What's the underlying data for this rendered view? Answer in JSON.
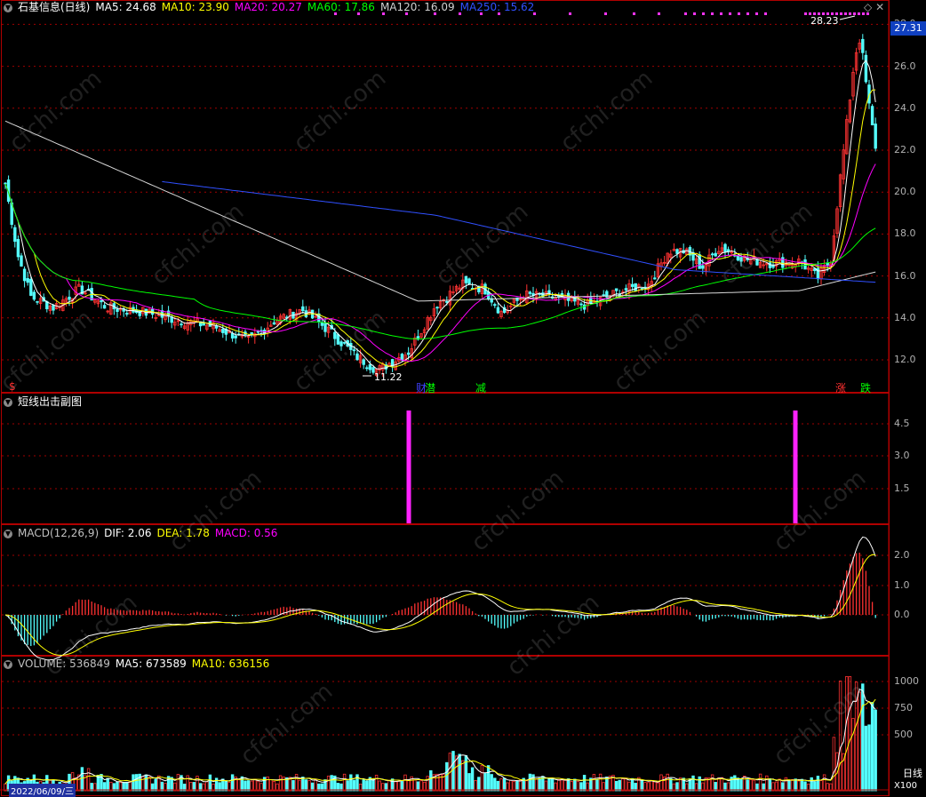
{
  "main": {
    "title": "石基信息(日线)",
    "ma_labels": [
      {
        "text": "MA5: 24.68",
        "color": "#ffffff"
      },
      {
        "text": "MA10: 23.90",
        "color": "#ffff00"
      },
      {
        "text": "MA20: 20.27",
        "color": "#ff00ff"
      },
      {
        "text": "MA60: 17.86",
        "color": "#00ff00"
      },
      {
        "text": "MA120: 16.09",
        "color": "#d0d0d0"
      },
      {
        "text": "MA250: 15.62",
        "color": "#3050ff"
      }
    ],
    "y_ticks": [
      "28.0",
      "26.0",
      "24.0",
      "22.0",
      "20.0",
      "18.0",
      "16.0",
      "14.0",
      "12.0"
    ],
    "last_price": "27.31",
    "high_label": "28.23",
    "low_label": "11.22",
    "markers": [
      {
        "text": "$",
        "color": "#ff3030"
      },
      {
        "text": "财",
        "color": "#4040ff"
      },
      {
        "text": "潜",
        "color": "#00ff00"
      },
      {
        "text": "减",
        "color": "#00ff00"
      },
      {
        "text": "涨",
        "color": "#ff3030"
      },
      {
        "text": "跌",
        "color": "#00ff00"
      }
    ]
  },
  "sub1": {
    "title": "短线出击副图",
    "y_ticks": [
      "4.5",
      "3.0",
      "1.5"
    ],
    "bars": [
      1,
      1
    ]
  },
  "macd": {
    "labels": [
      {
        "text": "MACD(12,26,9)",
        "color": "#c0c0c0"
      },
      {
        "text": "DIF: 2.06",
        "color": "#ffffff"
      },
      {
        "text": "DEA: 1.78",
        "color": "#ffff00"
      },
      {
        "text": "MACD: 0.56",
        "color": "#ff00ff"
      }
    ],
    "y_ticks": [
      "2.0",
      "1.0",
      "0.0"
    ]
  },
  "volume": {
    "labels": [
      {
        "text": "VOLUME: 536849",
        "color": "#c0c0c0"
      },
      {
        "text": "MA5: 673589",
        "color": "#ffffff"
      },
      {
        "text": "MA10: 636156",
        "color": "#ffff00"
      }
    ],
    "y_ticks": [
      "1000",
      "750",
      "500"
    ],
    "unit": "X100",
    "date": "2022/06/09/三"
  },
  "sidebar_label": "日线",
  "watermark": "cfchi.com",
  "colors": {
    "up": "#ff3232",
    "down": "#54ffff",
    "grid": "#a00000",
    "border": "#b00000"
  }
}
